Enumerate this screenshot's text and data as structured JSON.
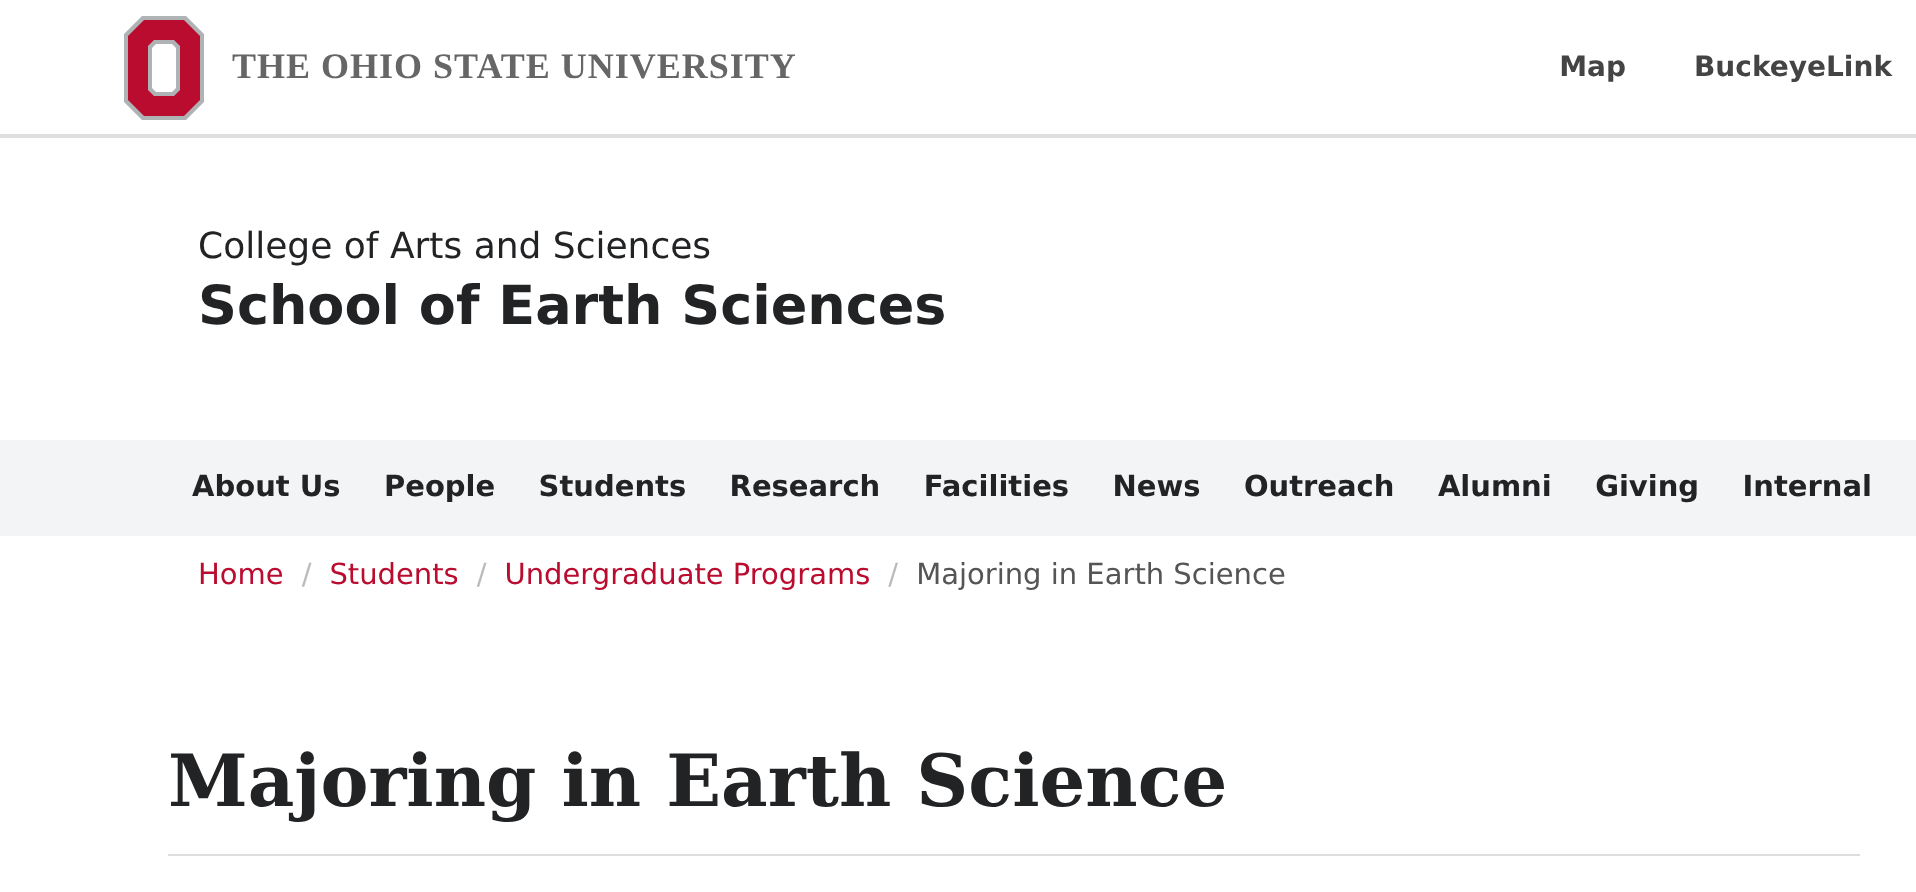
{
  "header": {
    "university": "THE OHIO STATE UNIVERSITY",
    "links": [
      "Map",
      "BuckeyeLink"
    ]
  },
  "site": {
    "college": "College of Arts and Sciences",
    "title": "School of Earth Sciences"
  },
  "nav": [
    "About Us",
    "People",
    "Students",
    "Research",
    "Facilities",
    "News",
    "Outreach",
    "Alumni",
    "Giving",
    "Internal"
  ],
  "breadcrumb": {
    "items": [
      {
        "label": "Home",
        "kind": "link"
      },
      {
        "label": "Students",
        "kind": "link"
      },
      {
        "label": "Undergraduate Programs",
        "kind": "link"
      },
      {
        "label": "Majoring in Earth Science",
        "kind": "current"
      }
    ],
    "separators": [
      "/",
      "/",
      "/"
    ]
  },
  "page_title": "Majoring in Earth Science"
}
